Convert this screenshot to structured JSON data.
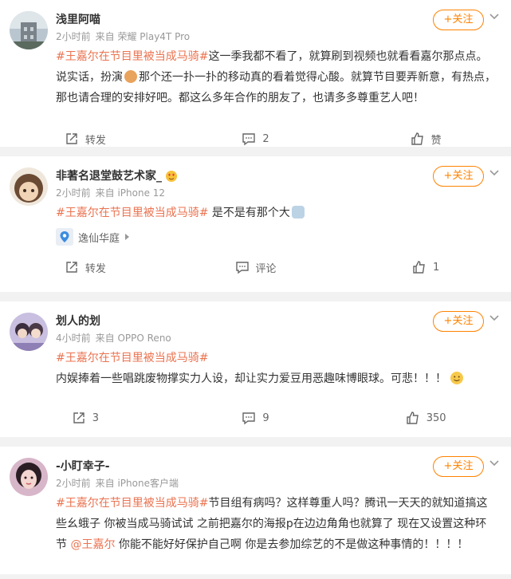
{
  "posts": [
    {
      "user": "浅里阿喵",
      "time": "2小时前",
      "source": "来自 荣耀 Play4T Pro",
      "follow": "+关注",
      "tag": "#王嘉尔在节目里被当成马骑#",
      "text1": "这一季我都不看了，就算刷到视频也就看看嘉尔那点点。说实话，扮演",
      "text2": "那个还一扑一扑的移动真的看着觉得心酸。就算节目要弄新意，有热点，那也请合理的安排好吧。都这么多年合作的朋友了，也请多多尊重艺人吧！",
      "repost": "转发",
      "comments": "2",
      "likes": "赞"
    },
    {
      "user": "非著名退堂鼓艺术家_",
      "time": "2小时前",
      "source": "来自 iPhone 12",
      "follow": "+关注",
      "tag": "#王嘉尔在节目里被当成马骑#",
      "text1": " 是不是有那个大",
      "location": "逸仙华庭",
      "repost": "转发",
      "comments": "评论",
      "likes": "1"
    },
    {
      "user": "划人的划",
      "time": "4小时前",
      "source": "来自 OPPO Reno",
      "follow": "+关注",
      "tag": "#王嘉尔在节目里被当成马骑#",
      "text1": "内娱捧着一些唱跳废物撑实力人设，却让实力爱豆用恶趣味博眼球。可悲！！！",
      "repost": "3",
      "comments": "9",
      "likes": "350"
    },
    {
      "user": "-小盯幸子-",
      "time": "2小时前",
      "source": "来自 iPhone客户端",
      "follow": "+关注",
      "tag": "#王嘉尔在节目里被当成马骑#",
      "text1": "节目组有病吗？这样尊重人吗？腾讯一天天的就知道搞这些幺蛾子 你被当成马骑试试 之前把嘉尔的海报p在边边角角也就算了 现在又设置这种环节 ",
      "mention": "@王嘉尔",
      "text2": " 你能不能好好保护自己啊 你是去参加综艺的不是做这种事情的！！！！"
    }
  ],
  "colors": {
    "accent": "#ff8200",
    "topic": "#eb7350",
    "meta": "#999999"
  },
  "icons": [
    "chevron-down-icon",
    "repost-icon",
    "comment-icon",
    "like-icon",
    "location-pin-icon"
  ]
}
